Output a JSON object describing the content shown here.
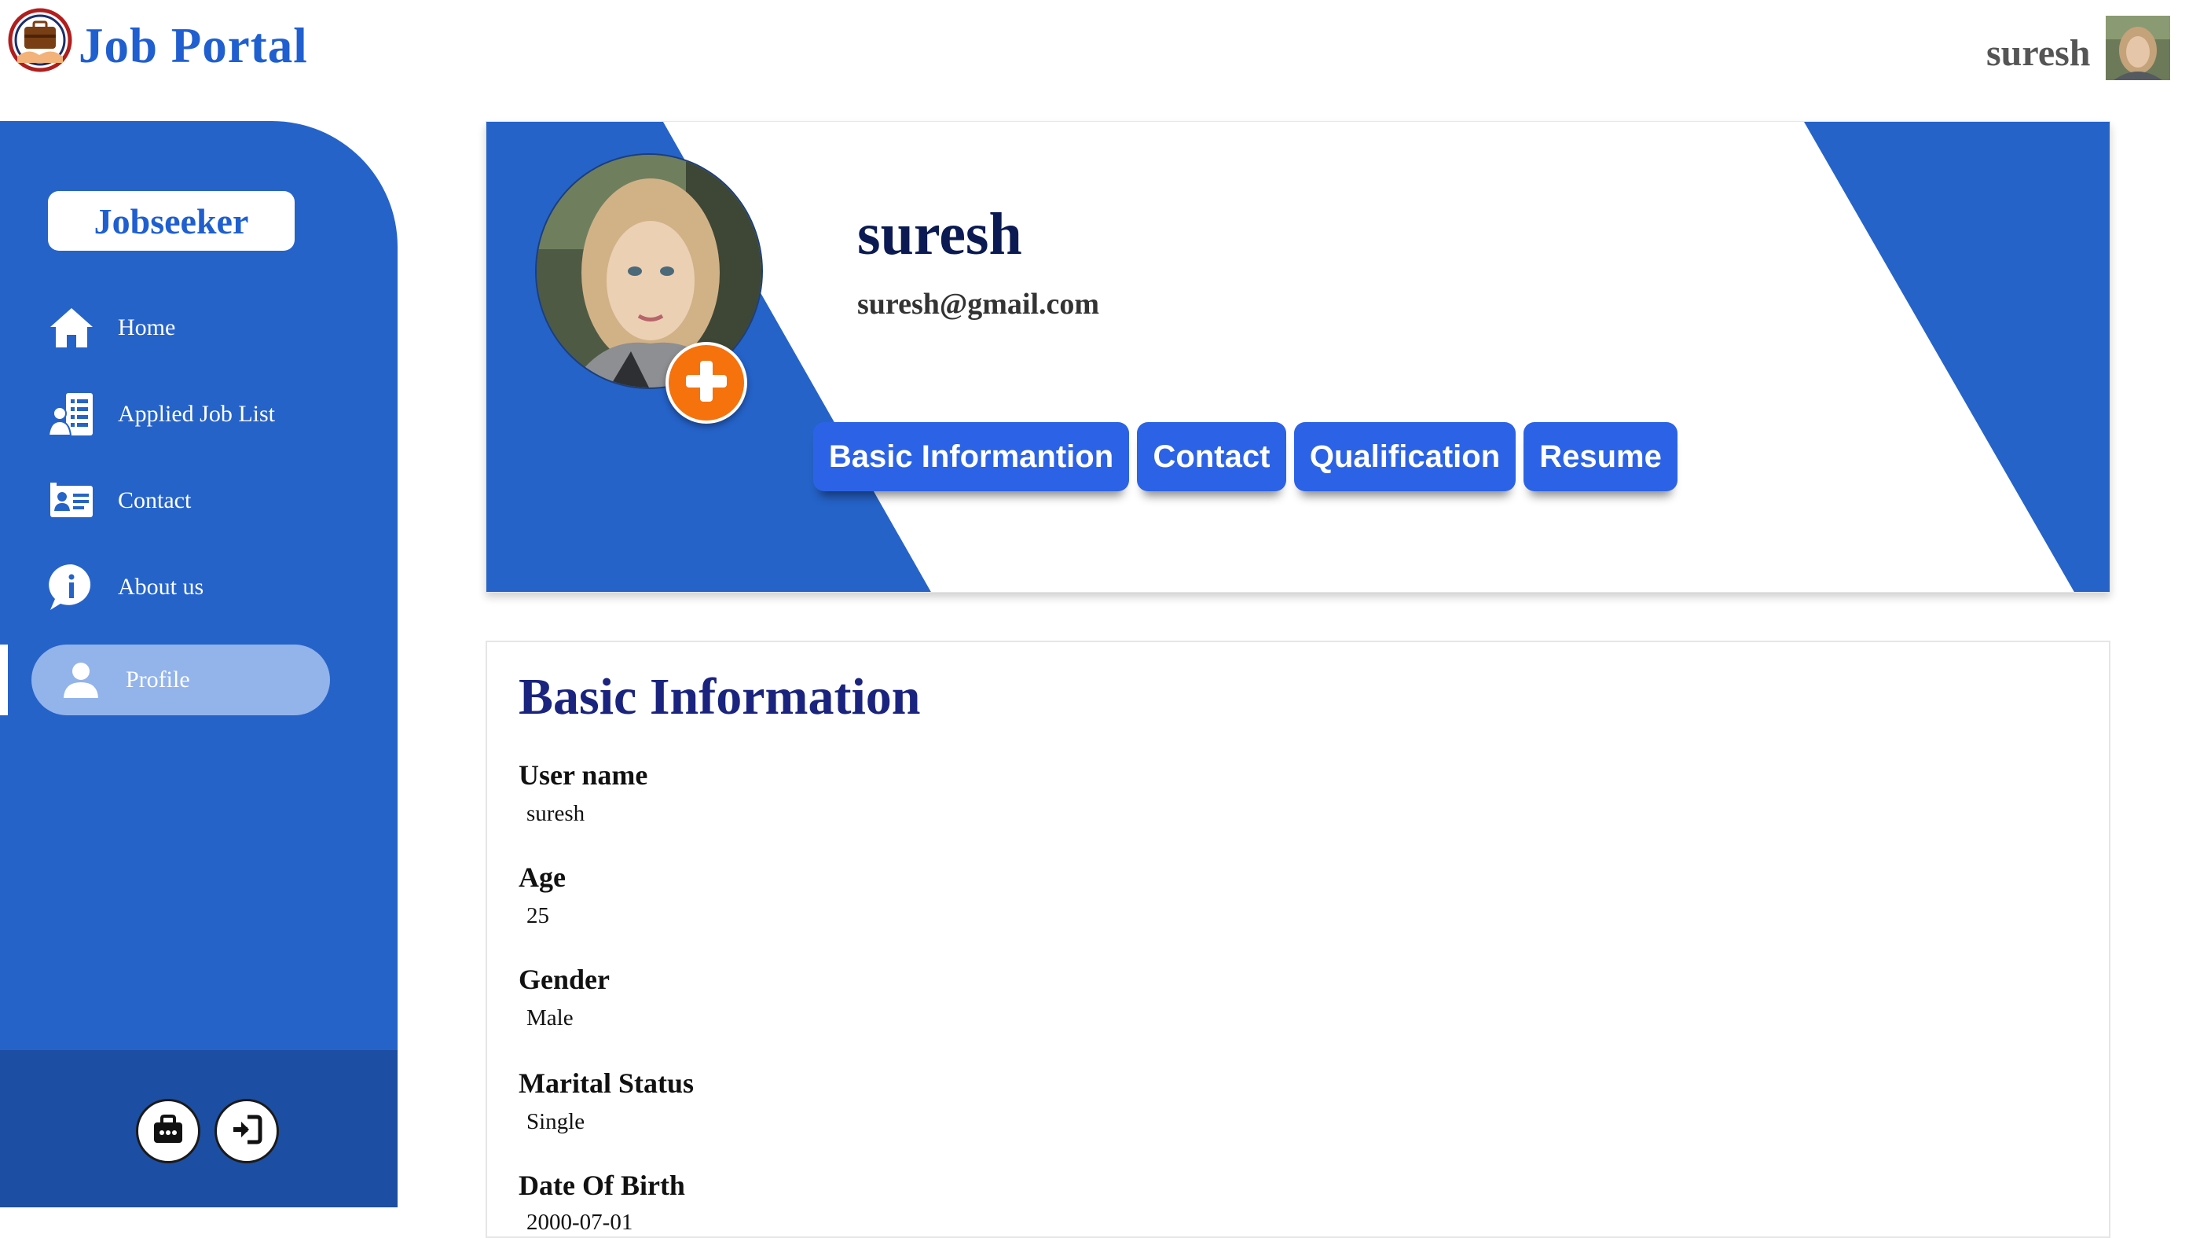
{
  "header": {
    "brand": "Job Portal",
    "user_name": "suresh"
  },
  "sidebar": {
    "role": "Jobseeker",
    "items": [
      {
        "label": "Home",
        "icon": "home-icon"
      },
      {
        "label": "Applied Job List",
        "icon": "applied-job-list-icon"
      },
      {
        "label": "Contact",
        "icon": "contact-card-icon"
      },
      {
        "label": "About us",
        "icon": "info-icon"
      },
      {
        "label": "Profile",
        "icon": "user-icon",
        "active": true
      }
    ],
    "footer_buttons": [
      {
        "icon": "briefcase-lock-icon"
      },
      {
        "icon": "logout-icon"
      }
    ]
  },
  "profile": {
    "name": "suresh",
    "email": "suresh@gmail.com",
    "tabs": [
      "Basic Informantion",
      "Contact",
      "Qualification",
      "Resume"
    ]
  },
  "basic_info": {
    "title": "Basic Information",
    "fields": [
      {
        "label": "User name",
        "value": "suresh"
      },
      {
        "label": "Age",
        "value": "25"
      },
      {
        "label": "Gender",
        "value": "Male"
      },
      {
        "label": "Marital Status",
        "value": "Single"
      },
      {
        "label": "Date Of Birth",
        "value": "2000-07-01"
      }
    ]
  },
  "colors": {
    "brand_blue": "#1f5fd0",
    "sidebar_blue": "#2563c9",
    "sidebar_footer": "#1c4ea3",
    "active_pill": "#93b4ea",
    "tab_blue": "#2c63e6",
    "add_button_orange": "#f5720d",
    "title_navy": "#1a237e"
  }
}
